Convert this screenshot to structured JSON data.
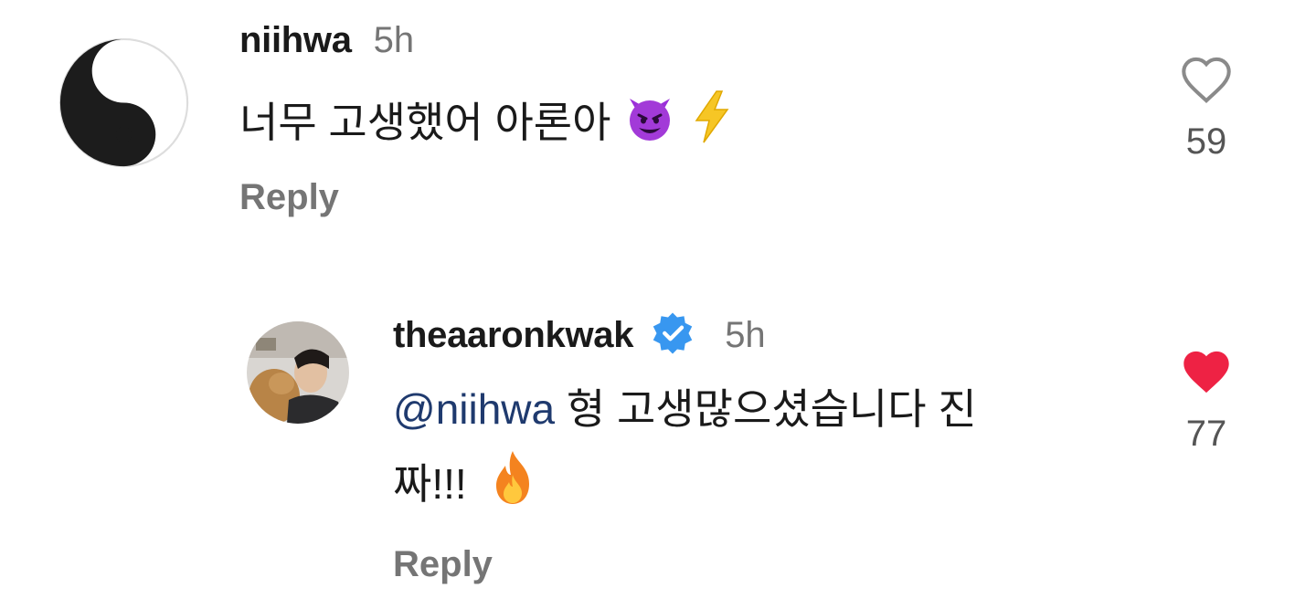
{
  "comments": [
    {
      "username": "niihwa",
      "time": "5h",
      "text": "너무 고생했어 아론아",
      "emojis": [
        "smiling-devil",
        "lightning"
      ],
      "reply_label": "Reply",
      "likes": "59",
      "liked": false,
      "avatar": "yin-yang-icon"
    },
    {
      "username": "theaaronkwak",
      "verified": true,
      "time": "5h",
      "mention": "@niihwa",
      "text_line1": "형 고생많으셨습니다 진",
      "text_line2": "짜!!!",
      "emojis": [
        "fire"
      ],
      "reply_label": "Reply",
      "likes": "77",
      "liked": true,
      "avatar": "profile-photo"
    }
  ],
  "colors": {
    "liked_heart": "#ee2244",
    "verified_badge": "#3897f0",
    "mention": "#1f3a6e",
    "muted": "#757575"
  }
}
